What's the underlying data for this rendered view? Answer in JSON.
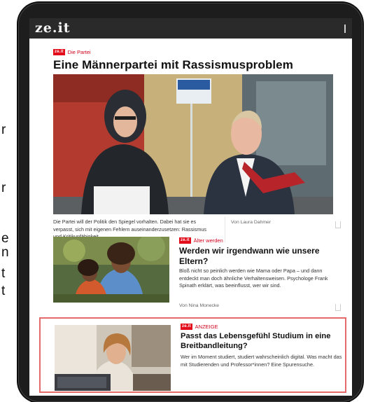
{
  "page_edge_text": [
    "r",
    "r",
    "e",
    "n",
    "t",
    "t"
  ],
  "app": {
    "logo": "ze.it"
  },
  "lead": {
    "kicker_badge": "ze.it",
    "kicker_label": "Die Partei",
    "headline": "Eine Männerpartei mit Rassismusproblem",
    "caption": "Die Partei will der Politik den Spiegel vorhalten. Dabei hat sie es verpasst, sich mit eigenen Fehlern auseinanderzusetzen: Rassismus und Kritikunfähigkeit.",
    "author": "Von Laura Dahmer"
  },
  "article2": {
    "kicker_badge": "ze.it",
    "kicker_label": "Älter werden",
    "headline": "Werden wir irgendwann wie unsere Eltern?",
    "teaser": "Bloß nicht so peinlich werden wie Mama oder Papa – und dann entdeckt man doch ähnliche Verhaltensweisen. Psychologe Frank Spinath erklärt, was beeinflusst, wer wir sind.",
    "author": "Von Nina Monecke"
  },
  "ad": {
    "kicker_badge": "ze.it",
    "kicker_label": "ANZEIGE",
    "headline": "Passt das Lebensgefühl Studium in eine Breitbandleitung?",
    "teaser": "Wer im Moment studiert, studiert wahrscheinlich digital. Was macht das mit Studierenden und Professor*innen? Eine Spurensuche."
  },
  "colors": {
    "brand_red": "#e20c1a",
    "highlight_border": "#e56a6a",
    "appbar": "#2a2a2a"
  }
}
